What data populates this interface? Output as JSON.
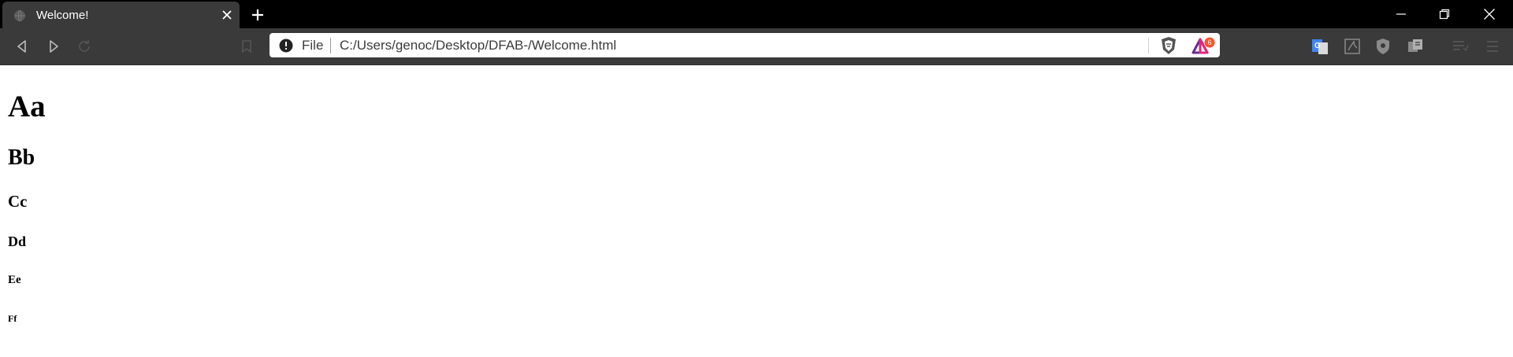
{
  "tab": {
    "title": "Welcome!",
    "favicon": "globe-icon"
  },
  "toolbar": {
    "scheme_label": "File",
    "url": "C:/Users/genoc/Desktop/DFAB-/Welcome.html",
    "rewards_badge": "6"
  },
  "page": {
    "h1": "Aa",
    "h2": "Bb",
    "h3": "Cc",
    "h4": "Dd",
    "h5": "Ee",
    "h6": "Ff"
  },
  "colors": {
    "tabstrip": "#000000",
    "toolbar": "#3a3a3a",
    "accent_red": "#fb542b",
    "translate_blue": "#4285f4"
  }
}
